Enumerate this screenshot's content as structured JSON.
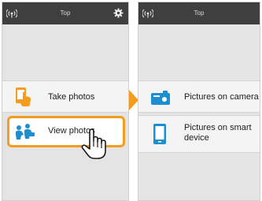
{
  "left_screen": {
    "header": {
      "title": "Top",
      "signal_icon": "wifi-signal-icon",
      "settings_icon": "gear-icon"
    },
    "menu": [
      {
        "label": "Take photos",
        "icon": "camera-touch-icon"
      },
      {
        "label": "View photos",
        "icon": "people-photos-icon",
        "highlighted": true
      }
    ],
    "pointer_icon": "hand-pointer-icon"
  },
  "transition_icon": "arrow-right-icon",
  "right_screen": {
    "header": {
      "title": "Top",
      "signal_icon": "wifi-signal-icon"
    },
    "menu": [
      {
        "label": "Pictures on camera",
        "icon": "camera-icon"
      },
      {
        "label": "Pictures on smart device",
        "icon": "smartphone-icon"
      }
    ]
  },
  "colors": {
    "accent": "#f39c1e",
    "header": "#3f3f3f",
    "icon_blue": "#1d8fd0",
    "background": "#e4e4e4"
  }
}
